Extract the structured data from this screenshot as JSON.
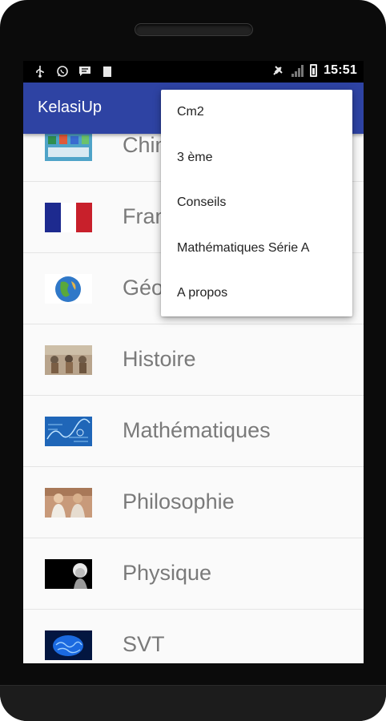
{
  "status_bar": {
    "time": "15:51",
    "left_icons": [
      "usb-icon",
      "whatsapp-icon",
      "message-icon",
      "notification-icon"
    ],
    "right_icons": [
      "vibrate-icon",
      "no-signal-icon",
      "battery-icon"
    ]
  },
  "app_bar": {
    "title": "KelasiUp",
    "color": "#2e43a3"
  },
  "subjects": [
    {
      "label": "Chimie",
      "icon": "chemistry-thumbnail"
    },
    {
      "label": "Français",
      "icon": "french-flag-thumbnail"
    },
    {
      "label": "Géographie",
      "icon": "globe-thumbnail"
    },
    {
      "label": "Histoire",
      "icon": "history-thumbnail"
    },
    {
      "label": "Mathématiques",
      "icon": "math-thumbnail"
    },
    {
      "label": "Philosophie",
      "icon": "philosophy-thumbnail"
    },
    {
      "label": "Physique",
      "icon": "einstein-thumbnail"
    },
    {
      "label": "SVT",
      "icon": "brain-thumbnail"
    }
  ],
  "overflow_menu": {
    "items": [
      "Cm2",
      "3 ème",
      "Conseils",
      "Mathématiques Série A",
      "A propos"
    ]
  }
}
